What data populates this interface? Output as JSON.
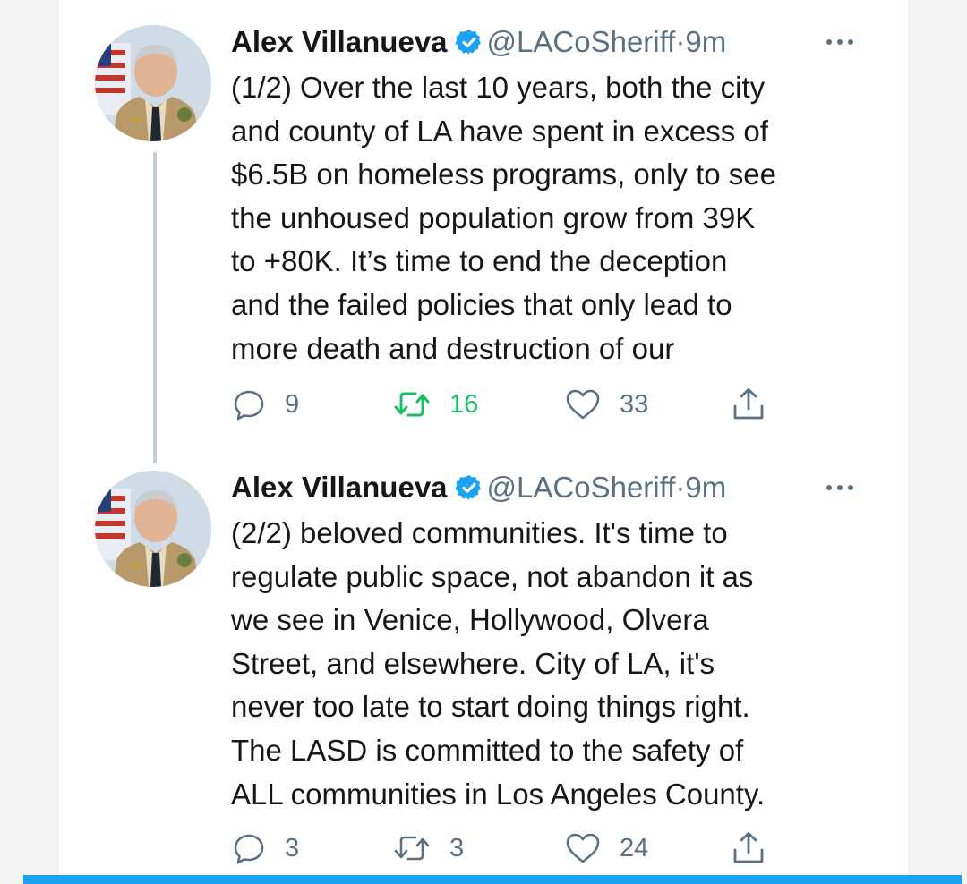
{
  "colors": {
    "accent": "#1da1f2",
    "retweet_active": "#17bf63",
    "secondary_text": "#5b7083",
    "primary_text": "#14171a",
    "verified": "#1da1f2"
  },
  "tweets": [
    {
      "author": {
        "name": "Alex Villanueva",
        "handle": "@LACoSheriff",
        "verified": true,
        "avatar_icon": "sheriff-portrait-avatar"
      },
      "separator": "·",
      "time": "9m",
      "text": "(1/2) Over the last 10 years, both the city\nand county of LA have spent in excess of\n$6.5B on homeless programs, only to see\nthe unhoused population grow from 39K\nto +80K.  It’s time to end the deception\nand the failed policies that only lead to\nmore death and destruction of our",
      "stats": {
        "replies": "9",
        "retweets": "16",
        "likes": "33"
      },
      "retweeted": true
    },
    {
      "author": {
        "name": "Alex Villanueva",
        "handle": "@LACoSheriff",
        "verified": true,
        "avatar_icon": "sheriff-portrait-avatar"
      },
      "separator": "·",
      "time": "9m",
      "text": "(2/2) beloved communities. It's time to\nregulate public space, not abandon it as\nwe see in Venice, Hollywood, Olvera\nStreet, and elsewhere.  City of LA, it's\nnever too late to start doing things right.\nThe LASD is committed to the safety of\nALL communities in Los Angeles County.",
      "stats": {
        "replies": "3",
        "retweets": "3",
        "likes": "24"
      },
      "retweeted": false
    }
  ]
}
